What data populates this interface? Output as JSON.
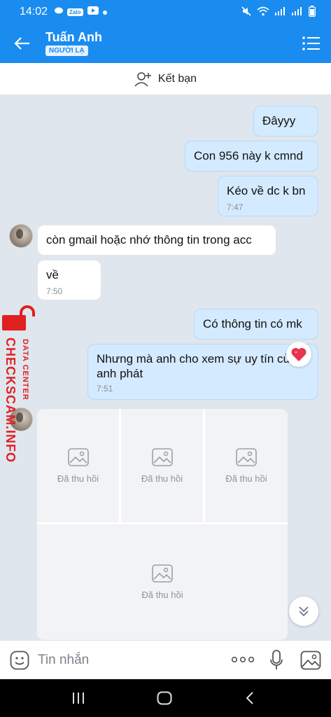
{
  "status_bar": {
    "time": "14:02",
    "zalo_badge": "Zalo"
  },
  "header": {
    "title": "Tuấn Anh",
    "badge": "NGƯỜI LẠ"
  },
  "add_friend": {
    "label": "Kết bạn"
  },
  "messages": [
    {
      "dir": "out",
      "text": "Đâyyy"
    },
    {
      "dir": "out",
      "text": "Con 956 này k cmnd"
    },
    {
      "dir": "out",
      "text": "Kéo về dc k bn",
      "time": "7:47"
    },
    {
      "dir": "in",
      "text": "còn gmail hoặc nhớ thông tin trong acc"
    },
    {
      "dir": "in",
      "text": "về",
      "time": "7:50"
    },
    {
      "dir": "out",
      "text": "Có thông tin có mk"
    },
    {
      "dir": "out",
      "text": "Nhưng mà anh cho xem sự uy tín của anh phát",
      "line1": "Nhưng mà anh cho xem sự uy tín của",
      "line2": "anh phát",
      "time": "7:51",
      "reaction": "heart"
    }
  ],
  "recalled": {
    "label": "Đã thu hồi"
  },
  "input": {
    "placeholder": "Tin nhắn"
  },
  "watermark": {
    "line1": "DATA CENTER",
    "line2": "CHECKSCAM.INFO"
  },
  "colors": {
    "primary": "#1a8cf0",
    "out_bubble": "#d4eaff",
    "watermark": "#e02020"
  }
}
